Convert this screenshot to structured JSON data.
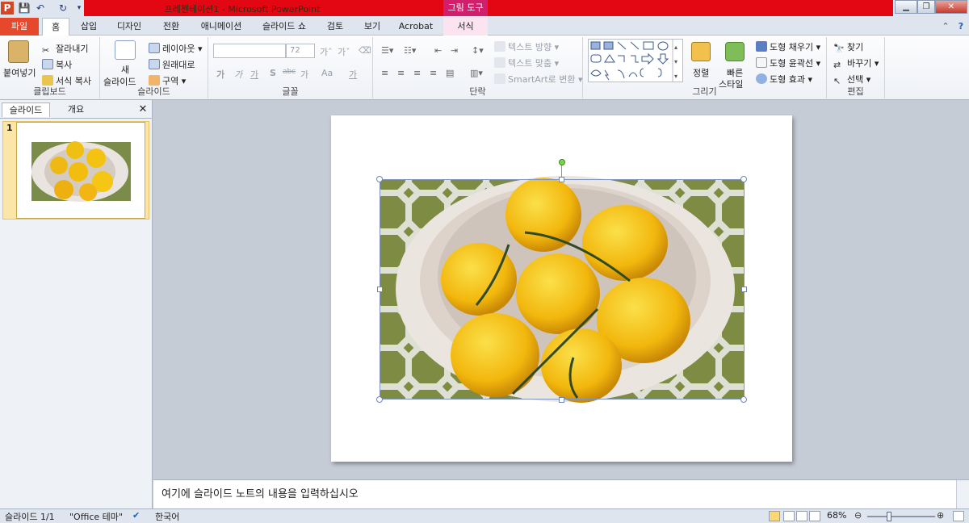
{
  "window": {
    "title": "프레젠테이션1 - Microsoft PowerPoint",
    "context_tool": "그림 도구"
  },
  "tabs": [
    {
      "label": "파일"
    },
    {
      "label": "홈"
    },
    {
      "label": "삽입"
    },
    {
      "label": "디자인"
    },
    {
      "label": "전환"
    },
    {
      "label": "애니메이션"
    },
    {
      "label": "슬라이드 쇼"
    },
    {
      "label": "검토"
    },
    {
      "label": "보기"
    },
    {
      "label": "Acrobat"
    },
    {
      "label": "서식"
    }
  ],
  "ribbon": {
    "clipboard": {
      "paste": "붙여넣기",
      "cut": "잘라내기",
      "copy": "복사",
      "format_painter": "서식 복사",
      "label": "클립보드"
    },
    "slides": {
      "new_slide_1": "새",
      "new_slide_2": "슬라이드",
      "layout": "레이아웃",
      "reset": "원래대로",
      "section": "구역",
      "label": "슬라이드"
    },
    "font": {
      "size": "72",
      "label": "글꼴",
      "bold": "가",
      "italic": "가",
      "underline": "가",
      "shadow": "S",
      "strike": "abc",
      "spacing": "가",
      "case": "Aa",
      "color": "가"
    },
    "paragraph": {
      "text_direction": "텍스트 방향",
      "align_text": "텍스트 맞춤",
      "smartart": "SmartArt로 변환",
      "label": "단락"
    },
    "drawing": {
      "arrange": "정렬",
      "quick_styles_1": "빠른",
      "quick_styles_2": "스타일",
      "shape_fill": "도형 채우기",
      "shape_outline": "도형 윤곽선",
      "shape_effects": "도형 효과",
      "label": "그리기"
    },
    "editing": {
      "find": "찾기",
      "replace": "바꾸기",
      "select": "선택",
      "label": "편집"
    }
  },
  "left_pane": {
    "tab_slides": "슬라이드",
    "tab_outline": "개요",
    "slide_number": "1"
  },
  "notes": {
    "placeholder": "여기에 슬라이드 노트의 내용을 입력하십시오"
  },
  "status": {
    "slide_info": "슬라이드 1/1",
    "theme": "\"Office 테마\"",
    "language": "한국어",
    "zoom": "68%"
  },
  "colors": {
    "title_bar_accent": "#e30613",
    "file_tab": "#e5482b",
    "context_tab": "#d21f6d"
  }
}
